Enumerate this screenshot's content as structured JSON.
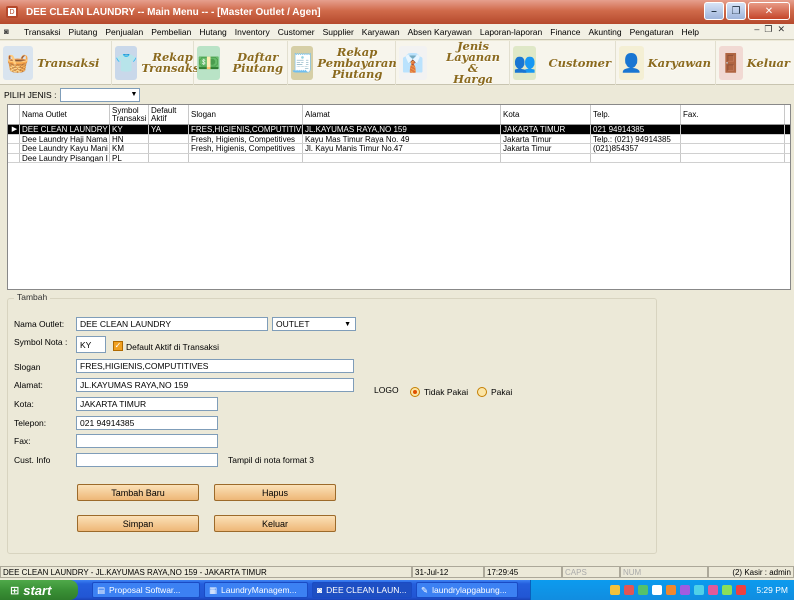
{
  "window": {
    "title": "DEE CLEAN LAUNDRY  -- Main Menu -- - [Master Outlet / Agen]"
  },
  "menu": [
    "Transaksi",
    "Piutang",
    "Penjualan",
    "Pembelian",
    "Hutang",
    "Inventory",
    "Customer",
    "Supplier",
    "Karyawan",
    "Absen Karyawan",
    "Laporan-laporan",
    "Finance",
    "Akunting",
    "Pengaturan",
    "Help"
  ],
  "toolbar": {
    "transaksi": "Transaksi",
    "rekap_transaksi_1": "Rekap",
    "rekap_transaksi_2": "Transaksi",
    "daftar_piutang_1": "Daftar",
    "daftar_piutang_2": "Piutang",
    "rekap_pembayaran_1": "Rekap",
    "rekap_pembayaran_2": "Pembayaran",
    "rekap_pembayaran_3": "Piutang",
    "jenis_layanan_1": "Jenis",
    "jenis_layanan_2": "Layanan &",
    "jenis_layanan_3": "Harga",
    "customer": "Customer",
    "karyawan": "Karyawan",
    "keluar": "Keluar"
  },
  "filter": {
    "label": "PILIH JENIS :",
    "value": ""
  },
  "grid": {
    "headers": [
      "Nama Outlet",
      "Symbol Transaksi",
      "Default Aktif",
      "Slogan",
      "Alamat",
      "Kota",
      "Telp.",
      "Fax."
    ],
    "rows": [
      [
        "DEE CLEAN LAUNDRY",
        "KY",
        "YA",
        "FRES,HIGIENIS,COMPUTITIVES",
        "JL.KAYUMAS RAYA,NO 159",
        "JAKARTA TIMUR",
        "021 94914385",
        ""
      ],
      [
        "Dee Laundry Haji Nama",
        "HN",
        "",
        "Fresh, Higienis, Competitives",
        "Kayu Mas Timur Raya No. 49",
        "Jakarta Timur",
        "Telp.: (021) 94914385",
        ""
      ],
      [
        "Dee Laundry Kayu Mani",
        "KM",
        "",
        "Fresh, Higienis, Competitives",
        "Jl. Kayu Manis Timur No.47",
        "Jakarta Timur",
        "(021)854357",
        ""
      ],
      [
        "Dee Laundry Pisangan I",
        "PL",
        "",
        "",
        "",
        "",
        "",
        ""
      ]
    ]
  },
  "form": {
    "group_title": "Tambah",
    "nama_outlet_label": "Nama Outlet:",
    "nama_outlet_value": "DEE CLEAN LAUNDRY",
    "jenis_value": "OUTLET",
    "symbol_label": "Symbol Nota :",
    "symbol_value": "KY",
    "default_aktif_label": "Default Aktif di Transaksi",
    "slogan_label": "Slogan",
    "slogan_value": "FRES,HIGIENIS,COMPUTITIVES",
    "alamat_label": "Alamat:",
    "alamat_value": "JL.KAYUMAS RAYA,NO 159",
    "kota_label": "Kota:",
    "kota_value": "JAKARTA TIMUR",
    "telepon_label": "Telepon:",
    "telepon_value": "021 94914385",
    "fax_label": "Fax:",
    "fax_value": "",
    "cust_info_label": "Cust. Info",
    "cust_info_value": "",
    "tampil_label": "Tampil di nota format 3",
    "logo_label": "LOGO",
    "tidak_pakai_label": "Tidak Pakai",
    "pakai_label": "Pakai",
    "btn_tambah": "Tambah Baru",
    "btn_hapus": "Hapus",
    "btn_simpan": "Simpan",
    "btn_keluar": "Keluar"
  },
  "status": {
    "info": "DEE CLEAN LAUNDRY - JL.KAYUMAS RAYA,NO 159 - JAKARTA TIMUR",
    "date": "31-Jul-12",
    "time": "17:29:45",
    "caps": "CAPS",
    "num": "NUM",
    "user": "(2) Kasir : admin"
  },
  "taskbar": {
    "start": "start",
    "tasks": [
      "Proposal Softwar...",
      "LaundryManagem...",
      "DEE CLEAN LAUN...",
      "laundrylapgabung..."
    ],
    "clock": "5:29 PM"
  }
}
